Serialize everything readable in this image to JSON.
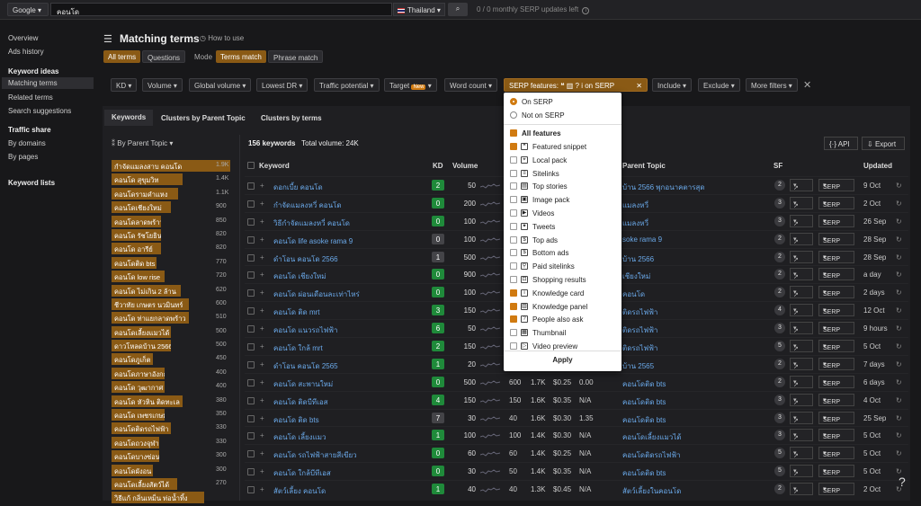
{
  "top": {
    "engine": "Google",
    "query": "คอนโด",
    "country": "Thailand",
    "serp_counter": "0 / 0 monthly SERP updates left"
  },
  "sidebar": {
    "overview": "Overview",
    "ads_history": "Ads history",
    "keyword_ideas": "Keyword ideas",
    "matching_terms": "Matching terms",
    "related_terms": "Related terms",
    "search_suggestions": "Search suggestions",
    "traffic_share": "Traffic share",
    "by_domains": "By domains",
    "by_pages": "By pages",
    "keyword_lists": "Keyword lists"
  },
  "page": {
    "title": "Matching terms",
    "how_to": "How to use",
    "all_terms": "All terms",
    "questions": "Questions",
    "mode": "Mode",
    "terms_match": "Terms match",
    "phrase_match": "Phrase match"
  },
  "filters": {
    "kd": "KD",
    "volume": "Volume",
    "global_volume": "Global volume",
    "lowest_dr": "Lowest DR",
    "traffic_potential": "Traffic potential",
    "target": "Target",
    "new": "New",
    "word_count": "Word count",
    "serp_features": "SERP features:",
    "on_serp_label": "on SERP",
    "include": "Include",
    "exclude": "Exclude",
    "more_filters": "More filters"
  },
  "tabs": {
    "keywords": "Keywords",
    "clusters_parent": "Clusters by Parent Topic",
    "clusters_terms": "Clusters by terms"
  },
  "left": {
    "by_parent": "By Parent Topic",
    "topics": [
      {
        "name": "กำจัดแมลงสาบ คอนโด",
        "count": "1.9K",
        "w": 1.0
      },
      {
        "name": "คอนโด สุขุมวิท",
        "count": "1.4K",
        "w": 0.6
      },
      {
        "name": "คอนโดรามคำแหง",
        "count": "1.1K",
        "w": 0.56
      },
      {
        "name": "คอนโดเชียงใหม่",
        "count": "900",
        "w": 0.5
      },
      {
        "name": "คอนโดลาดพร้าว",
        "count": "850",
        "w": 0.42
      },
      {
        "name": "คอนโด รัชโยธิน",
        "count": "820",
        "w": 0.42
      },
      {
        "name": "คอนโด อารีย์",
        "count": "820",
        "w": 0.42
      },
      {
        "name": "คอนโดติด bts",
        "count": "770",
        "w": 0.38
      },
      {
        "name": "คอนโด low rise",
        "count": "720",
        "w": 0.45
      },
      {
        "name": "คอนโด ไม่เกิน 2 ล้าน",
        "count": "620",
        "w": 0.58
      },
      {
        "name": "ชีวาทัย เกษตร นวมินทร์",
        "count": "600",
        "w": 0.65
      },
      {
        "name": "คอนโด ท่าแยกลาดพร้าว",
        "count": "510",
        "w": 0.65
      },
      {
        "name": "คอนโดเลี้ยงแมวได้",
        "count": "500",
        "w": 0.5
      },
      {
        "name": "ดาวโหลดบ้าน 2566",
        "count": "500",
        "w": 0.5
      },
      {
        "name": "คอนโดภูเก็ต",
        "count": "450",
        "w": 0.35
      },
      {
        "name": "คอนโดภาษาอังกฤษ",
        "count": "400",
        "w": 0.45
      },
      {
        "name": "คอนโด วุฒากาศ",
        "count": "400",
        "w": 0.45
      },
      {
        "name": "คอนโด หัวหิน ติดทะเล",
        "count": "380",
        "w": 0.6
      },
      {
        "name": "คอนโด เพชรเกษม",
        "count": "350",
        "w": 0.45
      },
      {
        "name": "คอนโดติดรถไฟฟ้า",
        "count": "330",
        "w": 0.5
      },
      {
        "name": "คอนโดถวงจุฬา",
        "count": "330",
        "w": 0.4
      },
      {
        "name": "คอนโดบางซ่อน",
        "count": "300",
        "w": 0.4
      },
      {
        "name": "คอนโดผังอน",
        "count": "300",
        "w": 0.35
      },
      {
        "name": "คอนโดเลี้ยงสัตว์ได้",
        "count": "270",
        "w": 0.55
      },
      {
        "name": "วิธีแก้ กลิ่นเหม็น ท่อน้ำทิ้ง",
        "count": "",
        "w": 0.78
      }
    ]
  },
  "summary": {
    "kw_count": "156 keywords",
    "total_volume": "Total volume: 24K"
  },
  "buttons": {
    "api": "API",
    "export": "Export"
  },
  "columns": {
    "keyword": "Keyword",
    "kd": "KD",
    "volume": "Volume",
    "parent_topic": "Parent Topic",
    "sf": "SF",
    "updated": "Updated"
  },
  "rows": [
    {
      "kw": "ดอกเบี้ย คอนโด",
      "kd": "2",
      "kdc": "#1f8a3a",
      "vol": "50",
      "c1": "",
      "c2": "",
      "c3": "",
      "c4": "",
      "tp": "บ้าน 2566 พุกอนาคตารสุด",
      "sf": "2",
      "upd": "9 Oct"
    },
    {
      "kw": "กำจัดแมลงหวี่ คอนโด",
      "kd": "0",
      "kdc": "#1f8a3a",
      "vol": "200",
      "c1": "",
      "c2": "",
      "c3": "",
      "c4": "",
      "tp": "แมลงหวี่",
      "sf": "3",
      "upd": "2 Oct"
    },
    {
      "kw": "วิธีกำจัดแมลงหวี่ คอนโด",
      "kd": "0",
      "kdc": "#1f8a3a",
      "vol": "100",
      "c1": "",
      "c2": "",
      "c3": "",
      "c4": "",
      "tp": "แมลงหวี่",
      "sf": "3",
      "upd": "26 Sep"
    },
    {
      "kw": "คอนโด life asoke rama 9",
      "kd": "0",
      "kdc": "#444448",
      "vol": "100",
      "c1": "",
      "c2": "",
      "c3": "",
      "c4": "",
      "tp": "soke rama 9",
      "sf": "2",
      "upd": "28 Sep"
    },
    {
      "kw": "ดำโอน คอนโด 2566",
      "kd": "1",
      "kdc": "#444448",
      "vol": "500",
      "c1": "",
      "c2": "",
      "c3": "",
      "c4": "",
      "tp": "บ้าน 2566",
      "sf": "2",
      "upd": "28 Sep"
    },
    {
      "kw": "คอนโด เชียงใหม่",
      "kd": "0",
      "kdc": "#1f8a3a",
      "vol": "900",
      "c1": "",
      "c2": "",
      "c3": "",
      "c4": "",
      "tp": "เชียงใหม่",
      "sf": "2",
      "upd": "a day"
    },
    {
      "kw": "คอนโด ผ่อนเดือนละเท่าไหร่",
      "kd": "0",
      "kdc": "#1f8a3a",
      "vol": "100",
      "c1": "",
      "c2": "",
      "c3": "",
      "c4": "",
      "tp": "คอนโด",
      "sf": "2",
      "upd": "2 days"
    },
    {
      "kw": "คอนโด ติด mrt",
      "kd": "3",
      "kdc": "#1f8a3a",
      "vol": "150",
      "c1": "",
      "c2": "",
      "c3": "",
      "c4": "",
      "tp": "ติดรถไฟฟ้า",
      "sf": "4",
      "upd": "12 Oct"
    },
    {
      "kw": "คอนโด แนวรถไฟฟ้า",
      "kd": "6",
      "kdc": "#1f8a3a",
      "vol": "50",
      "c1": "",
      "c2": "",
      "c3": "",
      "c4": "",
      "tp": "ติดรถไฟฟ้า",
      "sf": "3",
      "upd": "9 hours"
    },
    {
      "kw": "คอนโด ใกล้ mrt",
      "kd": "2",
      "kdc": "#1f8a3a",
      "vol": "150",
      "c1": "",
      "c2": "",
      "c3": "",
      "c4": "",
      "tp": "ติดรถไฟฟ้า",
      "sf": "5",
      "upd": "5 Oct"
    },
    {
      "kw": "ดำโอน คอนโด 2565",
      "kd": "1",
      "kdc": "#1f8a3a",
      "vol": "20",
      "c1": "",
      "c2": "",
      "c3": "",
      "c4": "",
      "tp": "บ้าน 2565",
      "sf": "2",
      "upd": "7 days"
    },
    {
      "kw": "คอนโด สะพานใหม่",
      "kd": "0",
      "kdc": "#1f8a3a",
      "vol": "500",
      "c1": "600",
      "c2": "1.7K",
      "c3": "$0.25",
      "c4": "0.00",
      "tp": "คอนโดติด bts",
      "sf": "2",
      "upd": "6 days"
    },
    {
      "kw": "คอนโด ติดบีทีเอส",
      "kd": "4",
      "kdc": "#1f8a3a",
      "vol": "150",
      "c1": "150",
      "c2": "1.6K",
      "c3": "$0.35",
      "c4": "N/A",
      "tp": "คอนโดติด bts",
      "sf": "3",
      "upd": "4 Oct"
    },
    {
      "kw": "คอนโด ติด bts",
      "kd": "7",
      "kdc": "#444448",
      "vol": "30",
      "c1": "40",
      "c2": "1.6K",
      "c3": "$0.30",
      "c4": "1.35",
      "tp": "คอนโดติด bts",
      "sf": "3",
      "upd": "25 Sep"
    },
    {
      "kw": "คอนโด เลี้ยงแมว",
      "kd": "1",
      "kdc": "#1f8a3a",
      "vol": "100",
      "c1": "100",
      "c2": "1.4K",
      "c3": "$0.30",
      "c4": "N/A",
      "tp": "คอนโดเลี้ยงแมวได้",
      "sf": "3",
      "upd": "5 Oct"
    },
    {
      "kw": "คอนโด รถไฟฟ้าสายสีเขียว",
      "kd": "0",
      "kdc": "#1f8a3a",
      "vol": "60",
      "c1": "60",
      "c2": "1.4K",
      "c3": "$0.25",
      "c4": "N/A",
      "tp": "คอนโดติดรถไฟฟ้า",
      "sf": "5",
      "upd": "5 Oct"
    },
    {
      "kw": "คอนโด ใกล้บีทีเอส",
      "kd": "0",
      "kdc": "#1f8a3a",
      "vol": "30",
      "c1": "50",
      "c2": "1.4K",
      "c3": "$0.35",
      "c4": "N/A",
      "tp": "คอนโดติด bts",
      "sf": "5",
      "upd": "5 Oct"
    },
    {
      "kw": "สัตว์เลี้ยง คอนโด",
      "kd": "1",
      "kdc": "#1f8a3a",
      "vol": "40",
      "c1": "40",
      "c2": "1.3K",
      "c3": "$0.45",
      "c4": "N/A",
      "tp": "สัตว์เลี้ยงในคอนโด",
      "sf": "2",
      "upd": "2 Oct"
    }
  ],
  "row_buttons": {
    "trend": "↗",
    "serp": "SERP"
  },
  "dropdown": {
    "on_serp": "On SERP",
    "not_on_serp": "Not on SERP",
    "all_features": "All features",
    "apply": "Apply",
    "features": [
      {
        "label": "Featured snippet",
        "checked": true,
        "icon": "❝"
      },
      {
        "label": "Local pack",
        "checked": false,
        "icon": "⌖"
      },
      {
        "label": "Sitelinks",
        "checked": false,
        "icon": "≡"
      },
      {
        "label": "Top stories",
        "checked": false,
        "icon": "▤"
      },
      {
        "label": "Image pack",
        "checked": false,
        "icon": "▣"
      },
      {
        "label": "Videos",
        "checked": false,
        "icon": "▶"
      },
      {
        "label": "Tweets",
        "checked": false,
        "icon": "✦"
      },
      {
        "label": "Top ads",
        "checked": false,
        "icon": "$"
      },
      {
        "label": "Bottom ads",
        "checked": false,
        "icon": "$"
      },
      {
        "label": "Paid sitelinks",
        "checked": false,
        "icon": "⚲"
      },
      {
        "label": "Shopping results",
        "checked": false,
        "icon": "⊡"
      },
      {
        "label": "Knowledge card",
        "checked": true,
        "icon": "i"
      },
      {
        "label": "Knowledge panel",
        "checked": true,
        "icon": "▥"
      },
      {
        "label": "People also ask",
        "checked": true,
        "icon": "?"
      },
      {
        "label": "Thumbnail",
        "checked": false,
        "icon": "▦"
      },
      {
        "label": "Video preview",
        "checked": false,
        "icon": "▷"
      }
    ]
  },
  "help": "?"
}
